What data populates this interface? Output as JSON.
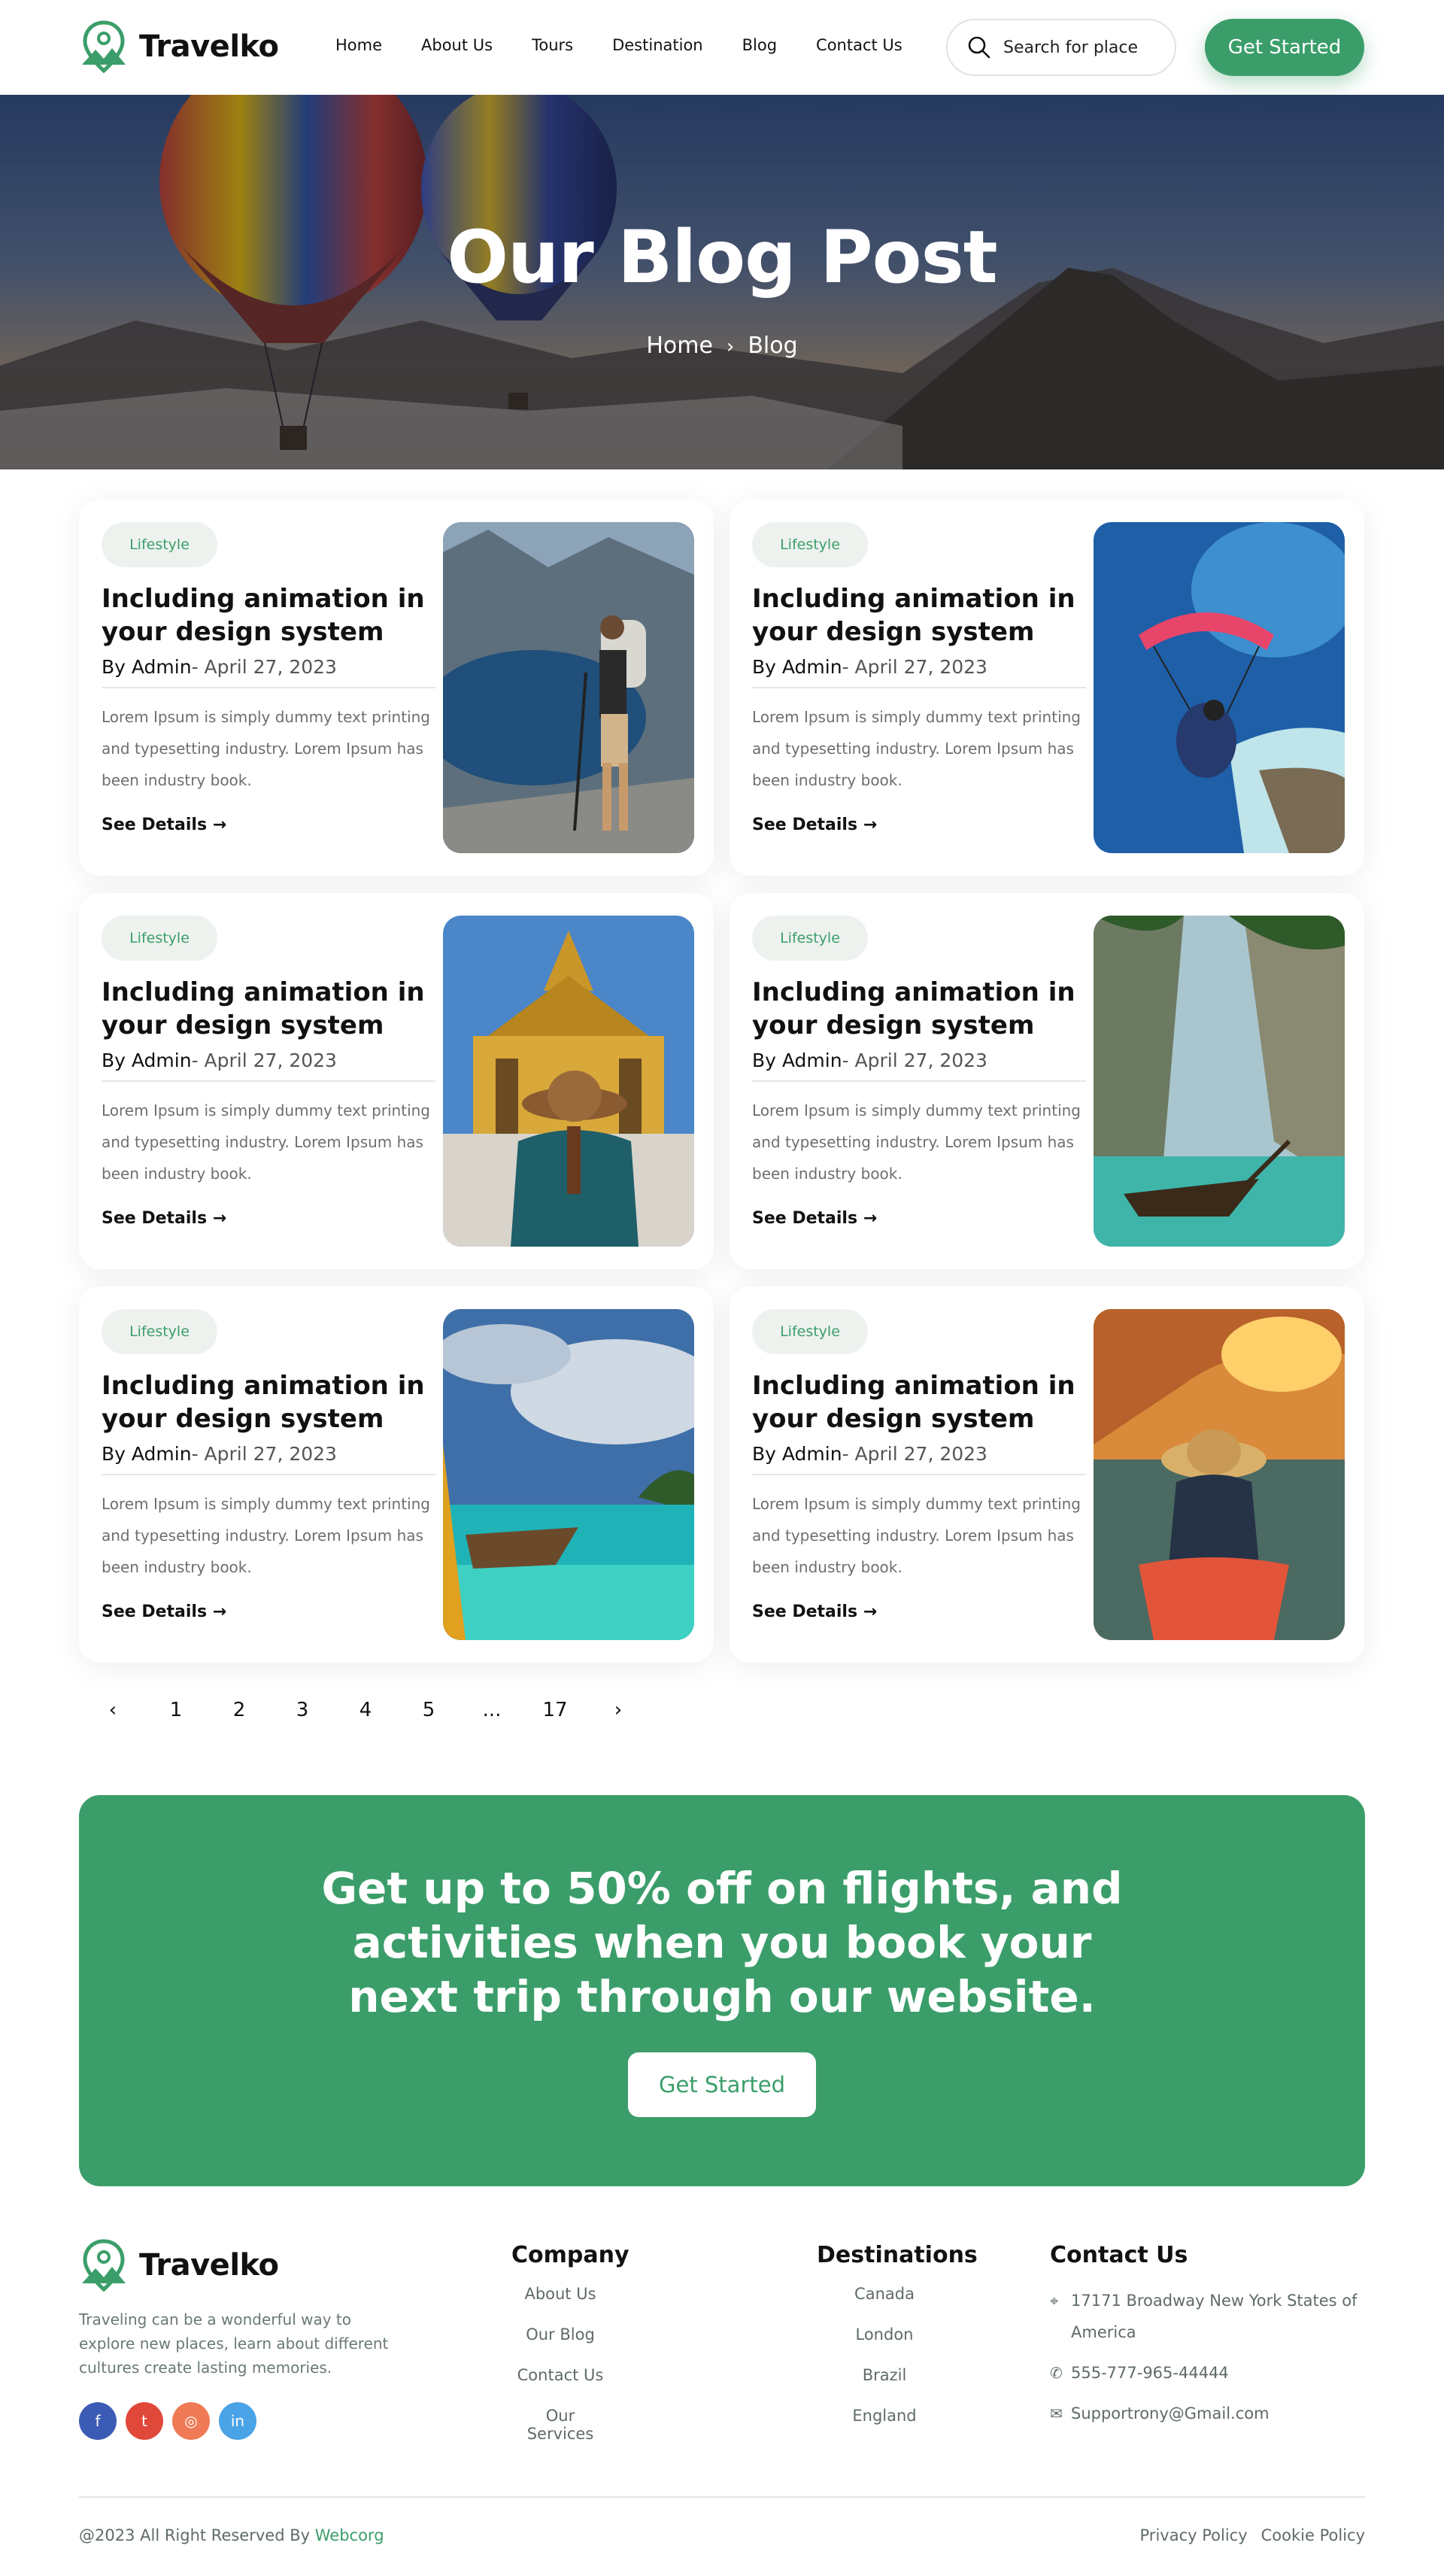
{
  "brand": {
    "name": "Travelko",
    "accent": "#3b9e6a"
  },
  "nav": {
    "items": [
      "Home",
      "About Us",
      "Tours",
      "Destination",
      "Blog",
      "Contact Us"
    ],
    "search_placeholder": "Search for place",
    "cta": "Get Started"
  },
  "hero": {
    "title": "Our Blog Post",
    "breadcrumb": [
      "Home",
      "Blog"
    ]
  },
  "posts": [
    {
      "tag": "Lifestyle",
      "title": "Including animation in your design system",
      "author": "By Admin",
      "date": "- April 27, 2023",
      "excerpt": "Lorem Ipsum is simply dummy text printing and typesetting industry. Lorem Ipsum has been industry book.",
      "link": "See Details",
      "image": "hiker-fjord"
    },
    {
      "tag": "Lifestyle",
      "title": "Including animation in your design system",
      "author": "By Admin",
      "date": "- April 27, 2023",
      "excerpt": "Lorem Ipsum is simply dummy text printing and typesetting industry. Lorem Ipsum has been industry book.",
      "link": "See Details",
      "image": "paraglider-coast"
    },
    {
      "tag": "Lifestyle",
      "title": "Including animation in your design system",
      "author": "By Admin",
      "date": "- April 27, 2023",
      "excerpt": "Lorem Ipsum is simply dummy text printing and typesetting industry. Lorem Ipsum has been industry book.",
      "link": "See Details",
      "image": "temple-traveler"
    },
    {
      "tag": "Lifestyle",
      "title": "Including animation in your design system",
      "author": "By Admin",
      "date": "- April 27, 2023",
      "excerpt": "Lorem Ipsum is simply dummy text printing and typesetting industry. Lorem Ipsum has been industry book.",
      "link": "See Details",
      "image": "longtail-boat-cliffs"
    },
    {
      "tag": "Lifestyle",
      "title": "Including animation in your design system",
      "author": "By Admin",
      "date": "- April 27, 2023",
      "excerpt": "Lorem Ipsum is simply dummy text printing and typesetting industry. Lorem Ipsum has been industry book.",
      "link": "See Details",
      "image": "boat-turquoise-sea"
    },
    {
      "tag": "Lifestyle",
      "title": "Including animation in your design system",
      "author": "By Admin",
      "date": "- April 27, 2023",
      "excerpt": "Lorem Ipsum is simply dummy text printing and typesetting industry. Lorem Ipsum has been industry book.",
      "link": "See Details",
      "image": "kayak-sea-cave"
    }
  ],
  "pagination": {
    "pages": [
      "1",
      "2",
      "3",
      "4",
      "5",
      "...",
      "17"
    ],
    "prev": "‹",
    "next": "›"
  },
  "promo": {
    "title": "Get up to 50% off on flights, and activities when you book your next trip through our website.",
    "cta": "Get Started"
  },
  "footer": {
    "about": "Traveling can be a wonderful way to explore new places, learn about different cultures create lasting memories.",
    "socials": [
      "facebook-icon",
      "twitter-icon",
      "instagram-icon",
      "linkedin-icon"
    ],
    "company": {
      "title": "Company",
      "links": [
        "About Us",
        "Our Blog",
        "Contact Us",
        "Our Services"
      ]
    },
    "destinations": {
      "title": "Destinations",
      "links": [
        "Canada",
        "London",
        "Brazil",
        "England"
      ]
    },
    "contact": {
      "title": "Contact Us",
      "address": "17171 Broadway New York States of America",
      "phone": "555-777-965-44444",
      "email": "Supportrony@Gmail.com"
    },
    "copyright": "@2023 All Right Reserved By",
    "copyright_brand": "Webcorg",
    "legal": [
      "Privacy Policy",
      "Cookie Policy"
    ]
  }
}
